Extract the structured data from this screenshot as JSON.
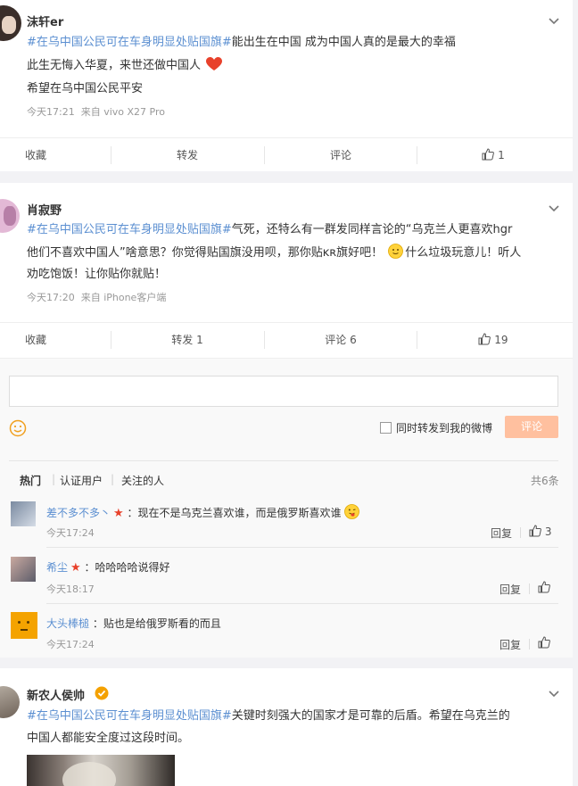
{
  "posts": [
    {
      "user": "沫轩er",
      "lines": [
        {
          "topic": "#在乌中国公民可在车身明显处贴国旗#",
          "text": "能出生在中国 成为中国人真的是最大的幸福"
        },
        {
          "topic": "",
          "text": "此生无悔入华夏，来世还做中国人"
        },
        {
          "topic": "",
          "text": "希望在乌中国公民平安"
        }
      ],
      "time": "今天17:21",
      "source": "来自 vivo X27 Pro",
      "actions": {
        "fav": "收藏",
        "repost": "转发",
        "comment": "评论",
        "like": "1"
      }
    },
    {
      "user": "肖寂野",
      "lines": [
        {
          "topic": "#在乌中国公民可在车身明显处贴国旗#",
          "text": "气死，还特么有一群发同样言论的“乌克兰人更喜欢hgr"
        },
        {
          "topic": "",
          "text": "他们不喜欢中国人”啥意思？你觉得贴国旗没用呗，那你贴ĸʀ旗好吧！",
          "text2": "什么垃圾玩意儿！听人"
        },
        {
          "topic": "",
          "text": "劝吃饱饭！让你贴你就贴！"
        }
      ],
      "time": "今天17:20",
      "source": "来自 iPhone客户端",
      "actions": {
        "fav": "收藏",
        "repost": "转发 1",
        "comment": "评论 6",
        "like": "19"
      }
    },
    {
      "user": "新农人侯帅",
      "lines": [
        {
          "topic": "#在乌中国公民可在车身明显处贴国旗#",
          "text": "关键时刻强大的国家才是可靠的后盾。希望在乌克兰的"
        },
        {
          "topic": "",
          "text": "中国人都能安全度过这段时间。"
        }
      ]
    }
  ],
  "comment_box": {
    "also_repost": "同时转发到我的微博",
    "submit": "评论",
    "tabs": [
      "热门",
      "认证用户",
      "关注的人"
    ],
    "total": "共6条"
  },
  "comments": [
    {
      "name": "差不多不多丶",
      "text": "现在不是乌克兰喜欢谁，而是俄罗斯喜欢谁",
      "time": "今天17:24",
      "reply": "回复",
      "likes": "3"
    },
    {
      "name": "希尘",
      "text": "哈哈哈哈说得好",
      "time": "今天18:17",
      "reply": "回复",
      "likes": ""
    },
    {
      "name": "大头棒槌",
      "text": "贴也是给俄罗斯看的而且",
      "time": "今天17:24",
      "reply": "回复",
      "likes": ""
    }
  ],
  "colors": {
    "topic": "#5b8fd1",
    "submit_bg": "#ffc09f",
    "star": "#e8412b",
    "vip": "#f4a100"
  }
}
